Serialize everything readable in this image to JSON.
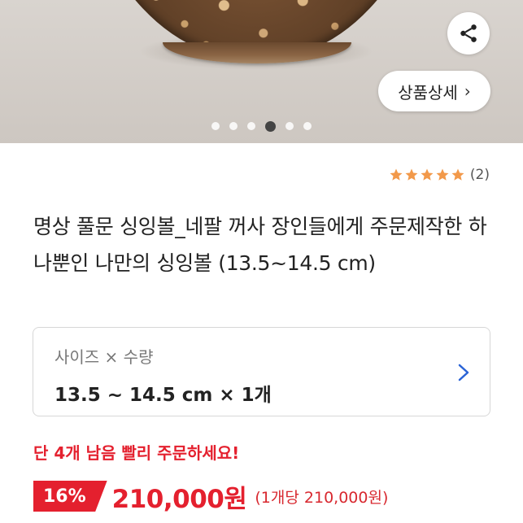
{
  "product_image": {
    "share_icon": "share-icon",
    "detail_button_label": "상품상세",
    "detail_chevron": "›",
    "carousel": {
      "total": 6,
      "active_index": 3
    }
  },
  "rating": {
    "stars": 5,
    "count_text": "(2)",
    "star_color": "#f2994a"
  },
  "product": {
    "title": "명상 풀문 싱잉볼_네팔 꺼사 장인들에게 주문제작한 하나뿐인 나만의 싱잉볼 (13.5~14.5 cm)"
  },
  "option": {
    "label": "사이즈 × 수량",
    "value": "13.5 ~ 14.5 cm × 1개",
    "chevron_icon": "chevron-right-icon"
  },
  "stock_notice": "단 4개 남음 빨리 주문하세요!",
  "price": {
    "discount": "16%",
    "amount": "210,000원",
    "unit_price": "(1개당 210,000원)"
  },
  "colors": {
    "accent_red": "#e4202e",
    "star": "#f2994a",
    "chevron_blue": "#2a63d6"
  }
}
